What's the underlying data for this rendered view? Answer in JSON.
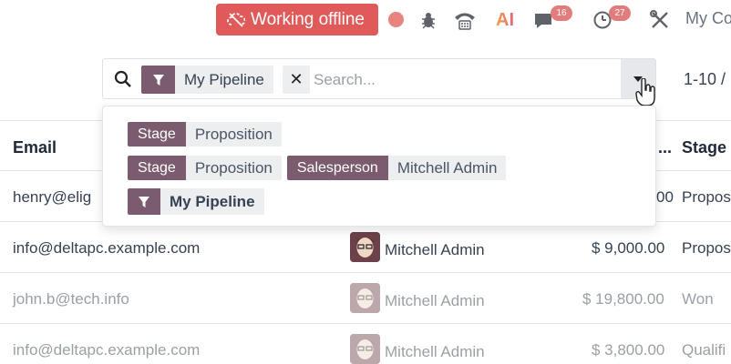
{
  "topbar": {
    "offline_label": "Working offline",
    "activity_badge": "27",
    "messages_badge": "16",
    "ai_label": "AI",
    "company_label": "My Co"
  },
  "search": {
    "facet_label": "My Pipeline",
    "placeholder": "Search...",
    "pager": "1-10 /"
  },
  "dropdown": {
    "recent": [
      {
        "tags": [
          {
            "field": "Stage",
            "value": "Proposition"
          }
        ]
      },
      {
        "tags": [
          {
            "field": "Stage",
            "value": "Proposition"
          },
          {
            "field": "Salesperson",
            "value": "Mitchell Admin"
          }
        ]
      }
    ],
    "favorite_label": "My Pipeline"
  },
  "table": {
    "headers": {
      "email": "Email",
      "revenue": "...",
      "stage": "Stage"
    },
    "rows": [
      {
        "email": "henry@elig",
        "salesperson": "",
        "revenue": "00",
        "stage": "Propos"
      },
      {
        "email": "info@deltapc.example.com",
        "salesperson": "Mitchell Admin",
        "revenue": "$ 9,000.00",
        "stage": "Propos"
      },
      {
        "email": "john.b@tech.info",
        "salesperson": "Mitchell Admin",
        "revenue": "$ 19,800.00",
        "stage": "Won"
      },
      {
        "email": "info@deltapc.example.com",
        "salesperson": "Mitchell Admin",
        "revenue": "$ 3,800.00",
        "stage": "Qualifi"
      }
    ]
  },
  "colors": {
    "offline_red": "#e05a5a",
    "facet_purple": "#7b5b6e",
    "badge_red": "#e27d7d"
  }
}
